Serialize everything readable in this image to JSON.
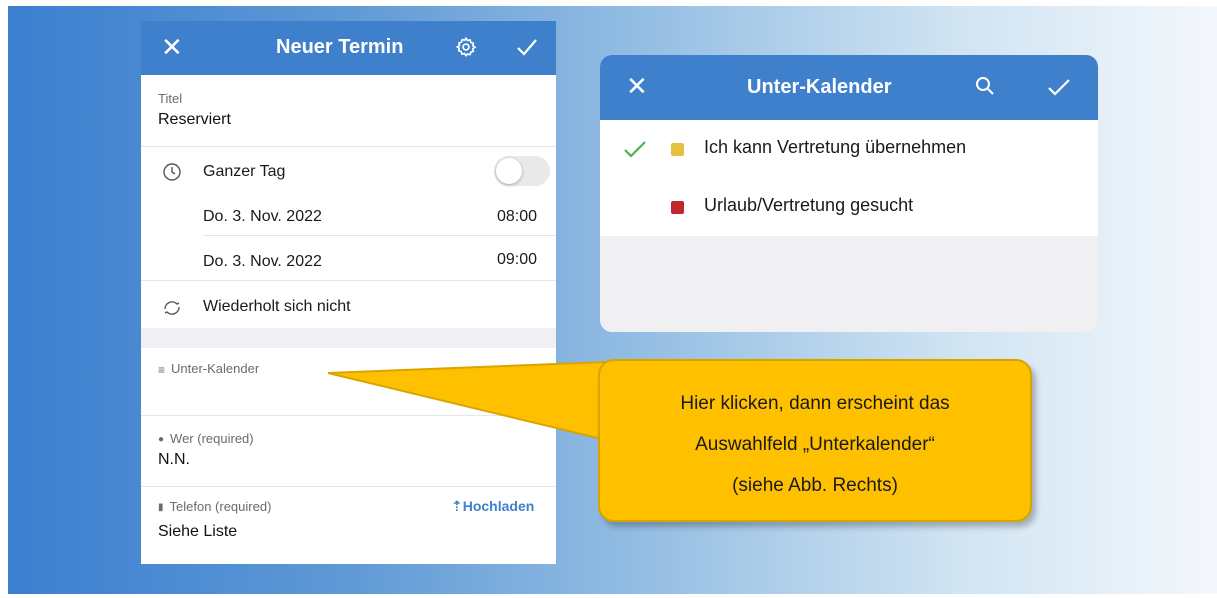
{
  "new_event": {
    "title": "Neuer Termin",
    "icons": [
      "close-icon",
      "gear-icon",
      "check-icon"
    ],
    "titel_label": "Titel",
    "titel_value": "Reserviert",
    "all_day_label": "Ganzer Tag",
    "start_date": "Do. 3. Nov. 2022",
    "start_time": "08:00",
    "end_date": "Do. 3. Nov. 2022",
    "end_time": "09:00",
    "repeat_label": "Wiederholt sich nicht",
    "subcalendar_label": "Unter-Kalender",
    "wer_label": "Wer (required)",
    "wer_value": "N.N.",
    "telefon_label": "Telefon (required)",
    "upload_label": "Hochladen",
    "telefon_value": "Siehe Liste"
  },
  "subcalendar_dialog": {
    "title": "Unter-Kalender",
    "icons": [
      "close-icon",
      "search-icon",
      "check-icon"
    ],
    "items": [
      {
        "label": "Ich kann Vertretung übernehmen",
        "color": "#e8c040",
        "checked": true
      },
      {
        "label": "Urlaub/Vertretung gesucht",
        "color": "#c0282d",
        "checked": false
      }
    ]
  },
  "callout": {
    "lines": [
      "Hier klicken, dann erscheint das",
      "Auswahlfeld „Unterkalender“",
      "(siehe Abb. Rechts)"
    ],
    "color": "#ffc000"
  },
  "colors": {
    "header_blue": "#3f80cc",
    "check_green": "#4caf50"
  }
}
